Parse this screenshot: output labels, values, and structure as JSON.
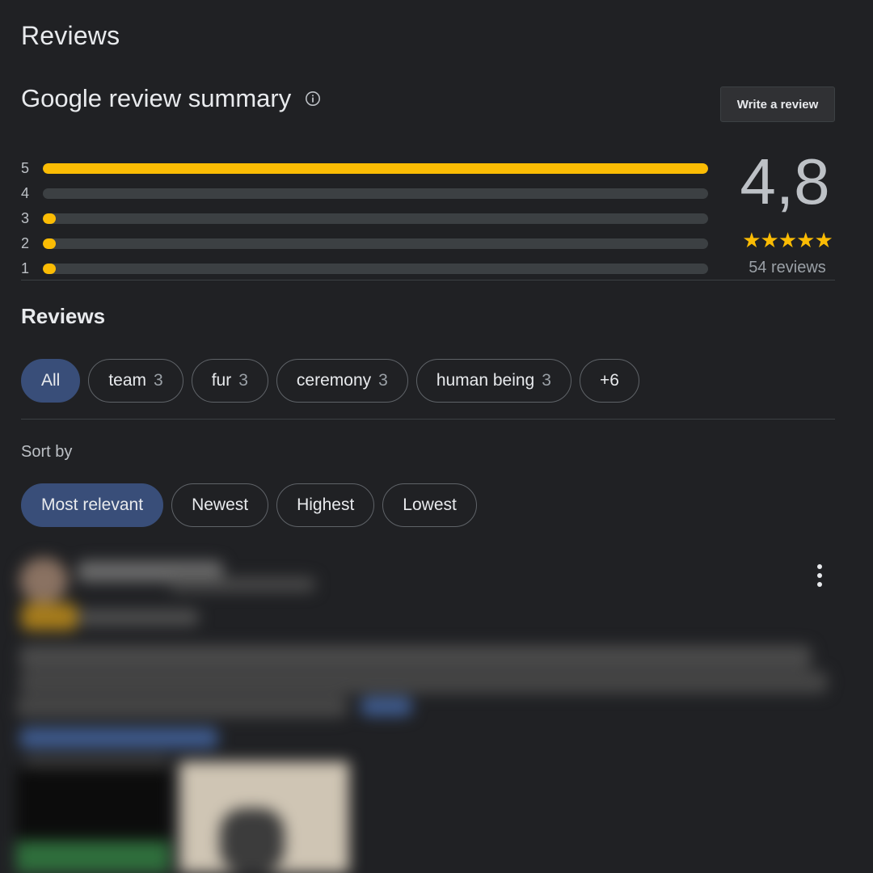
{
  "header": {
    "title": "Reviews"
  },
  "summary": {
    "title": "Google review summary",
    "info_icon": "info-icon",
    "write_review_label": "Write a review",
    "rating": "4,8",
    "stars": "★★★★★",
    "review_count": "54 reviews",
    "distribution": [
      {
        "stars": "5",
        "fraction": 1.0
      },
      {
        "stars": "4",
        "fraction": 0.0
      },
      {
        "stars": "3",
        "fraction": 0.02
      },
      {
        "stars": "2",
        "fraction": 0.02
      },
      {
        "stars": "1",
        "fraction": 0.02
      }
    ],
    "bar_color": "#fbbc04"
  },
  "reviews_section": {
    "title": "Reviews",
    "topics": [
      {
        "label": "All",
        "count": "",
        "active": true
      },
      {
        "label": "team",
        "count": "3",
        "active": false
      },
      {
        "label": "fur",
        "count": "3",
        "active": false
      },
      {
        "label": "ceremony",
        "count": "3",
        "active": false
      },
      {
        "label": "human being",
        "count": "3",
        "active": false
      },
      {
        "label": "+6",
        "count": "",
        "active": false
      }
    ],
    "sort_label": "Sort by",
    "sort_options": [
      {
        "label": "Most relevant",
        "active": true
      },
      {
        "label": "Newest",
        "active": false
      },
      {
        "label": "Highest",
        "active": false
      },
      {
        "label": "Lowest",
        "active": false
      }
    ],
    "more_icon": "more-vert-icon"
  },
  "colors": {
    "background": "#202124",
    "accent_chip": "#394e79",
    "star": "#fbbc04"
  }
}
